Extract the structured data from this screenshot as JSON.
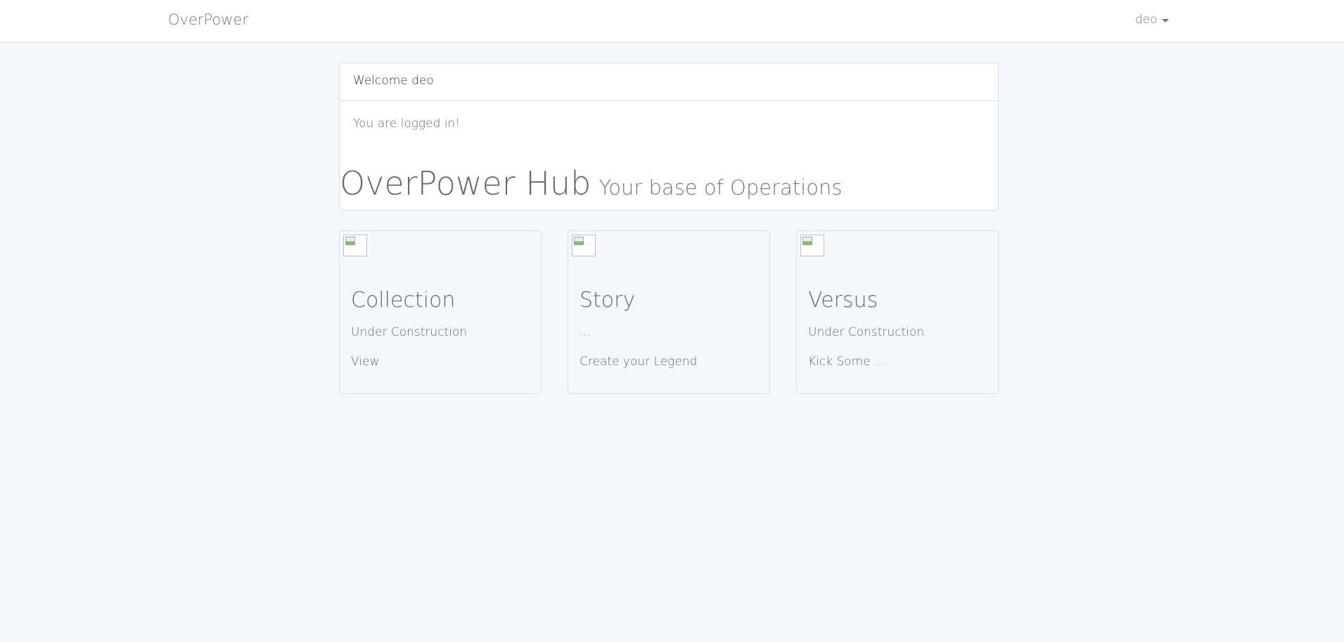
{
  "navbar": {
    "brand": "OverPower",
    "user": "deo"
  },
  "panel": {
    "heading": "Welcome deo",
    "body": "You are logged in!",
    "hub_title": "OverPower Hub",
    "hub_subtitle": "Your base of Operations"
  },
  "cards": [
    {
      "img_alt": "...",
      "title": "Collection",
      "description": "Under Construction",
      "link": "View"
    },
    {
      "img_alt": "...",
      "title": "Story",
      "description": "...",
      "link": "Create your Legend"
    },
    {
      "img_alt": "...",
      "title": "Versus",
      "description": "Under Construction",
      "link": "Kick Some ..."
    }
  ],
  "icons": {
    "user_menu": "caret-down-icon",
    "card_image": "broken-image-icon"
  },
  "colors": {
    "background": "#f5f8fa",
    "border": "#d3e0e9",
    "text": "#636b6f"
  }
}
